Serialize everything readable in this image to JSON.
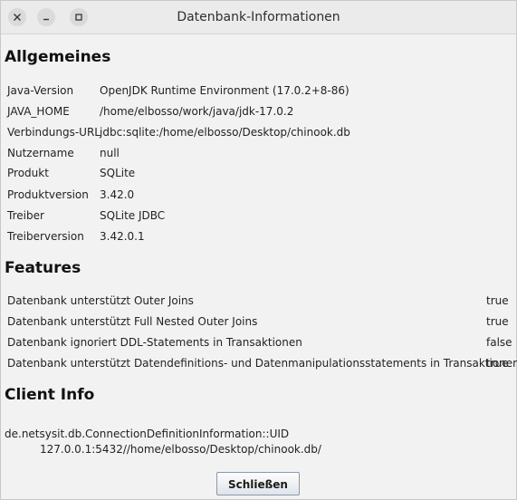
{
  "window": {
    "title": "Datenbank-Informationen"
  },
  "sections": {
    "general_title": "Allgemeines",
    "features_title": "Features",
    "client_title": "Client Info"
  },
  "general": [
    {
      "label": "Java-Version",
      "value": "OpenJDK Runtime Environment (17.0.2+8-86)"
    },
    {
      "label": "JAVA_HOME",
      "value": "/home/elbosso/work/java/jdk-17.0.2"
    },
    {
      "label": "Verbindungs-URL",
      "value": "jdbc:sqlite:/home/elbosso/Desktop/chinook.db"
    },
    {
      "label": "Nutzername",
      "value": "null"
    },
    {
      "label": "Produkt",
      "value": "SQLite"
    },
    {
      "label": "Produktversion",
      "value": "3.42.0"
    },
    {
      "label": "Treiber",
      "value": "SQLite JDBC"
    },
    {
      "label": "Treiberversion",
      "value": "3.42.0.1"
    }
  ],
  "features": [
    {
      "label": "Datenbank unterstützt Outer Joins",
      "value": "true"
    },
    {
      "label": "Datenbank unterstützt Full Nested Outer Joins",
      "value": "true"
    },
    {
      "label": "Datenbank ignoriert DDL-Statements in Transaktionen",
      "value": "false"
    },
    {
      "label": "Datenbank unterstützt Datendefinitions- und Datenmanipulationsstatements in Transaktionen",
      "value": "true"
    }
  ],
  "client": {
    "key": "de.netsysit.db.ConnectionDefinitionInformation::UID",
    "value": "127.0.0.1:5432//home/elbosso/Desktop/chinook.db/"
  },
  "buttons": {
    "close_label": "Schließen"
  },
  "icons": {
    "close": "close-icon",
    "minimize": "minimize-icon",
    "maximize": "maximize-icon"
  }
}
